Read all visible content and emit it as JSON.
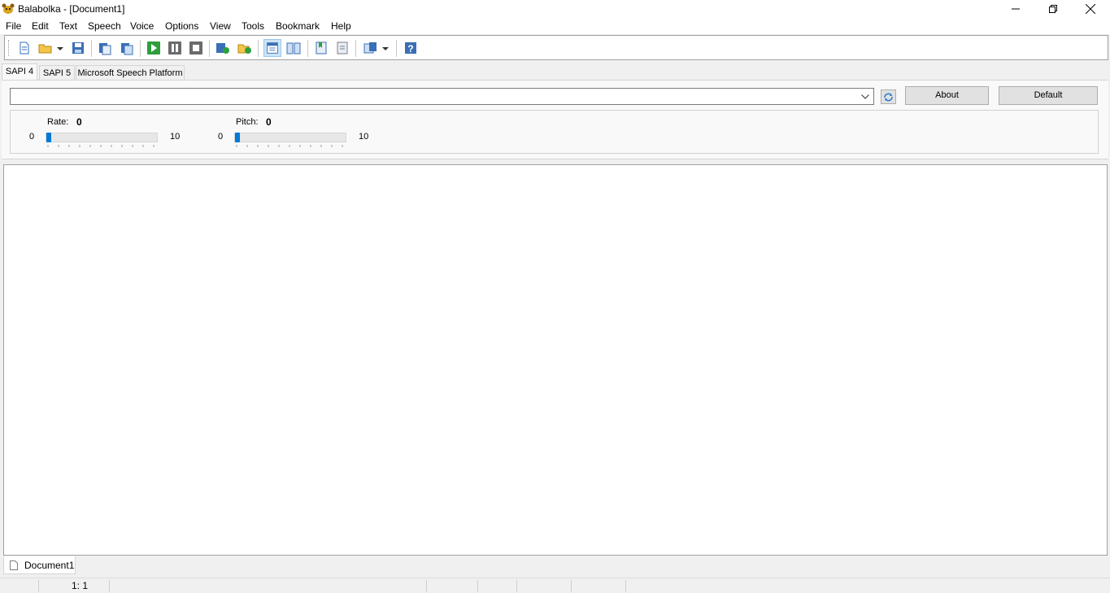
{
  "window": {
    "title": "Balabolka - [Document1]",
    "controls": [
      "minimize",
      "restore",
      "close"
    ]
  },
  "menu": [
    "File",
    "Edit",
    "Text",
    "Speech",
    "Voice",
    "Options",
    "View",
    "Tools",
    "Bookmark",
    "Help"
  ],
  "toolbar": {
    "icons": [
      "new-document-icon",
      "open-folder-icon",
      "open-dropdown-icon",
      "save-icon",
      "speak-clipboard-icon",
      "speak-clipboard-alt-icon",
      "play-icon",
      "pause-icon",
      "stop-icon",
      "convert-audio-icon",
      "save-audio-icon",
      "show-settings-icon",
      "book-icon",
      "add-bookmark-icon",
      "bookmarks-icon",
      "tool-dropdown-icon",
      "help-icon"
    ],
    "active": "show-settings-icon"
  },
  "tabs": [
    {
      "label": "SAPI 4",
      "active": true
    },
    {
      "label": "SAPI 5",
      "active": false
    },
    {
      "label": "Microsoft Speech Platform",
      "active": false
    }
  ],
  "voice": {
    "selected": "",
    "about_label": "About",
    "default_label": "Default"
  },
  "sliders": {
    "rate": {
      "label": "Rate:",
      "value": "0",
      "min": "0",
      "max": "10"
    },
    "pitch": {
      "label": "Pitch:",
      "value": "0",
      "min": "0",
      "max": "10"
    }
  },
  "editor": {
    "text": ""
  },
  "document_tab": {
    "label": "Document1"
  },
  "status": {
    "cursor": "1:  1"
  },
  "colors": {
    "accent": "#0078d7",
    "background": "#f0f0f0"
  }
}
